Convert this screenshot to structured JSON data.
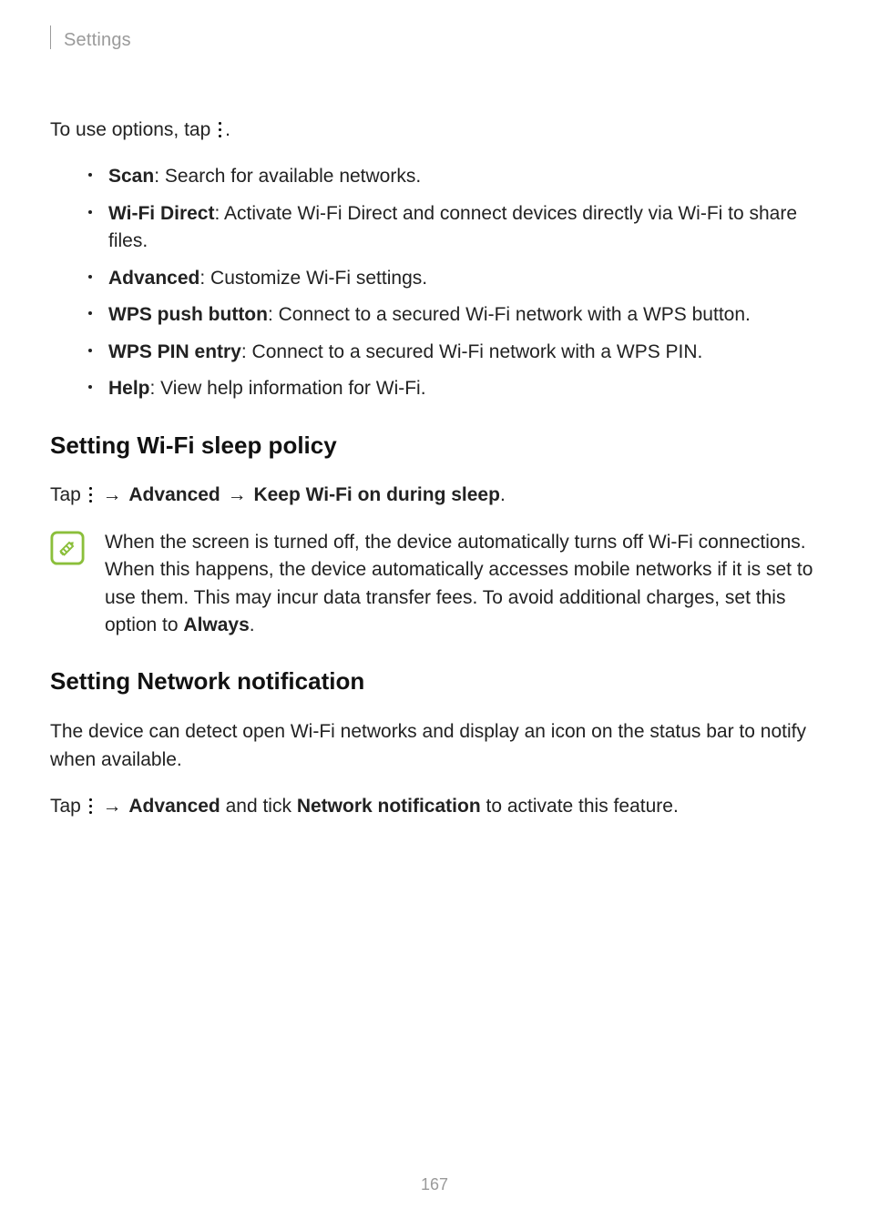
{
  "breadcrumb": "Settings",
  "intro": {
    "prefix": "To use options, tap",
    "suffix": "."
  },
  "options": [
    {
      "label": "Scan",
      "desc": ": Search for available networks."
    },
    {
      "label": "Wi-Fi Direct",
      "desc": ": Activate Wi-Fi Direct and connect devices directly via Wi-Fi to share files."
    },
    {
      "label": "Advanced",
      "desc": ": Customize Wi-Fi settings."
    },
    {
      "label": "WPS push button",
      "desc": ": Connect to a secured Wi-Fi network with a WPS button."
    },
    {
      "label": "WPS PIN entry",
      "desc": ": Connect to a secured Wi-Fi network with a WPS PIN."
    },
    {
      "label": "Help",
      "desc": ": View help information for Wi-Fi."
    }
  ],
  "section1": {
    "heading": "Setting Wi-Fi sleep policy",
    "steps": {
      "tap": "Tap",
      "advanced": "Advanced",
      "keep": "Keep Wi-Fi on during sleep",
      "period": "."
    },
    "note_pre": "When the screen is turned off, the device automatically turns off Wi-Fi connections. When this happens, the device automatically accesses mobile networks if it is set to use them. This may incur data transfer fees. To avoid additional charges, set this option to ",
    "note_bold": "Always",
    "note_post": "."
  },
  "section2": {
    "heading": "Setting Network notification",
    "para": "The device can detect open Wi-Fi networks and display an icon on the status bar to notify when available.",
    "steps": {
      "tap": "Tap",
      "advanced": "Advanced",
      "mid": " and tick ",
      "netnotif": "Network notification",
      "post": " to activate this feature."
    }
  },
  "page_number": "167",
  "arrow_glyph": "→"
}
